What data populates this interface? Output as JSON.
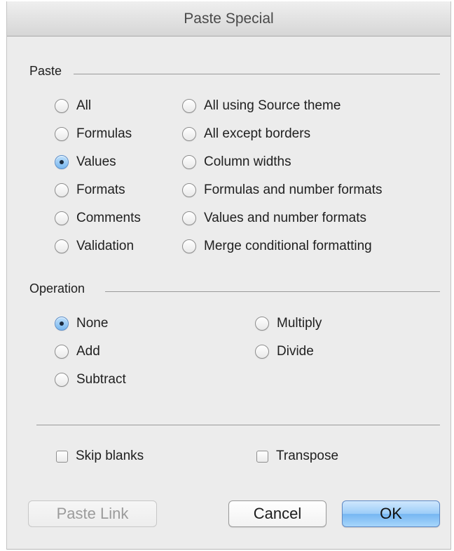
{
  "dialog": {
    "title": "Paste Special"
  },
  "paste": {
    "group_label": "Paste",
    "left_options": [
      "All",
      "Formulas",
      "Values",
      "Formats",
      "Comments",
      "Validation"
    ],
    "right_options": [
      "All using Source theme",
      "All except borders",
      "Column widths",
      "Formulas and number formats",
      "Values and number formats",
      "Merge conditional formatting"
    ],
    "selected": "Values"
  },
  "operation": {
    "group_label": "Operation",
    "left_options": [
      "None",
      "Add",
      "Subtract"
    ],
    "right_options": [
      "Multiply",
      "Divide"
    ],
    "selected": "None"
  },
  "options": {
    "skip_blanks_label": "Skip blanks",
    "skip_blanks_checked": false,
    "transpose_label": "Transpose",
    "transpose_checked": false
  },
  "buttons": {
    "paste_link": "Paste Link",
    "cancel": "Cancel",
    "ok": "OK"
  },
  "colors": {
    "dialog_bg": "#ececec",
    "selected_radio": "#78b7ef",
    "default_button": "#9ccdf8"
  }
}
